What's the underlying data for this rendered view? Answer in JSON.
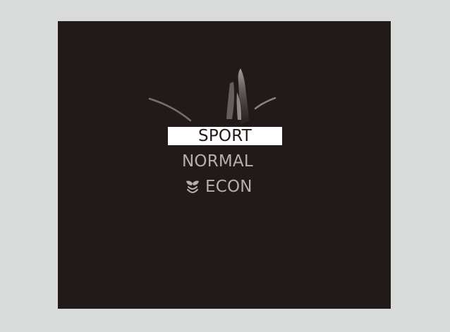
{
  "drive_modes": {
    "items": [
      {
        "label": "SPORT",
        "selected": true
      },
      {
        "label": "NORMAL",
        "selected": false
      },
      {
        "label": "ECON",
        "selected": false,
        "icon": "eco-leaf-icon"
      }
    ]
  },
  "colors": {
    "page_background": "#d9dbdb",
    "screen_background": "#211a18",
    "selected_background": "#ffffff",
    "selected_text": "#211a18",
    "unselected_text": "#b4b0ad"
  }
}
